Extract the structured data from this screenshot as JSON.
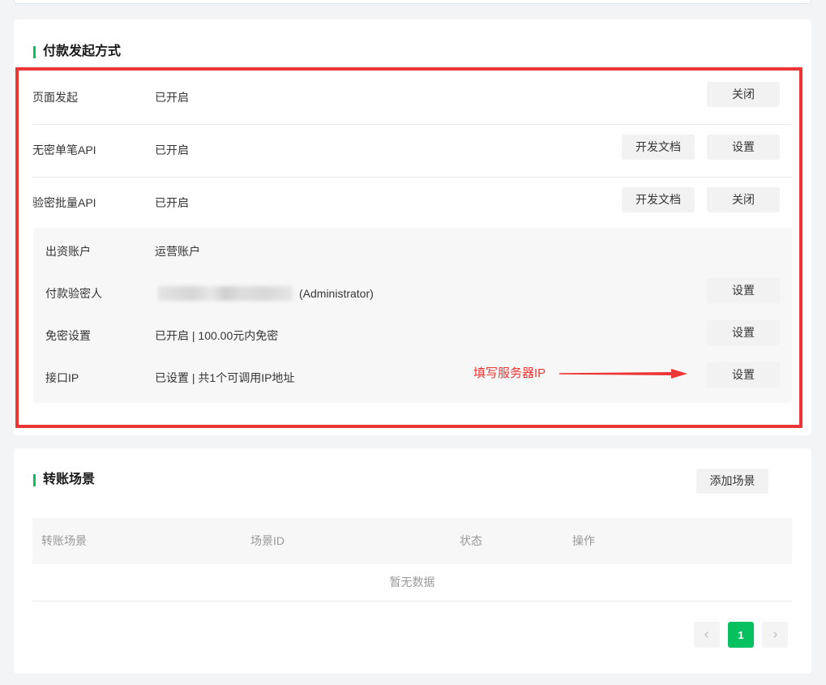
{
  "colors": {
    "accent": "#07c160",
    "annotation": "#ec3636",
    "page_background": "#f3f4f6",
    "button_background": "#f2f2f2",
    "muted_text": "#999999"
  },
  "payment_methods": {
    "title": "付款发起方式",
    "rows": [
      {
        "label": "页面发起",
        "status": "已开启",
        "buttons": [
          "关闭"
        ]
      },
      {
        "label": "无密单笔API",
        "status": "已开启",
        "buttons": [
          "开发文档",
          "设置"
        ]
      },
      {
        "label": "验密批量API",
        "status": "已开启",
        "buttons": [
          "开发文档",
          "关闭"
        ]
      }
    ],
    "batch_api_details": [
      {
        "label": "出资账户",
        "value": "运营账户"
      },
      {
        "label": "付款验密人",
        "value": "(Administrator)",
        "button": "设置"
      },
      {
        "label": "免密设置",
        "value": "已开启 | 100.00元内免密",
        "button": "设置"
      },
      {
        "label": "接口IP",
        "value": "已设置 | 共1个可调用IP地址",
        "button": "设置"
      }
    ]
  },
  "annotation": {
    "text": "填写服务器IP",
    "icon": "arrow-right-icon"
  },
  "transfer_scenes": {
    "title": "转账场景",
    "add_button": "添加场景",
    "columns": [
      "转账场景",
      "场景ID",
      "状态",
      "操作"
    ],
    "empty_text": "暂无数据",
    "pagination": {
      "prev_icon": "chevron-left-icon",
      "current_page": "1",
      "next_icon": "chevron-right-icon"
    }
  }
}
